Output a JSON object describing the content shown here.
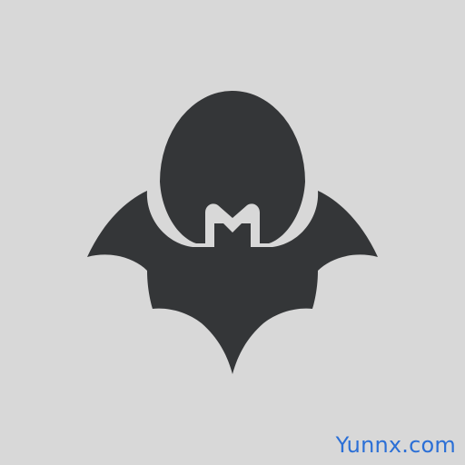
{
  "image": {
    "icon": "bat-icon",
    "colors": {
      "background": "#d8d8d8",
      "icon": "#343638",
      "watermark": "#2b6fd6"
    }
  },
  "watermark": {
    "text": "Yunnx.com"
  }
}
